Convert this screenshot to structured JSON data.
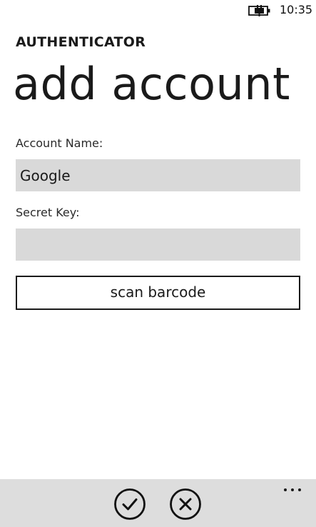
{
  "status_bar": {
    "time": "10:35",
    "battery_icon": "battery-charging-icon"
  },
  "header": {
    "app_title": "AUTHENTICATOR",
    "page_title": "add account"
  },
  "form": {
    "account_name": {
      "label": "Account Name:",
      "value": "Google"
    },
    "secret_key": {
      "label": "Secret Key:",
      "value": ""
    },
    "scan_button_label": "scan barcode"
  },
  "app_bar": {
    "buttons": [
      {
        "icon": "check-icon"
      },
      {
        "icon": "close-icon"
      }
    ],
    "more_icon": "ellipsis-icon"
  },
  "colors": {
    "background": "#ffffff",
    "text": "#1a1a1a",
    "input_background": "#d9d9d9",
    "app_bar_background": "#dddddd"
  }
}
